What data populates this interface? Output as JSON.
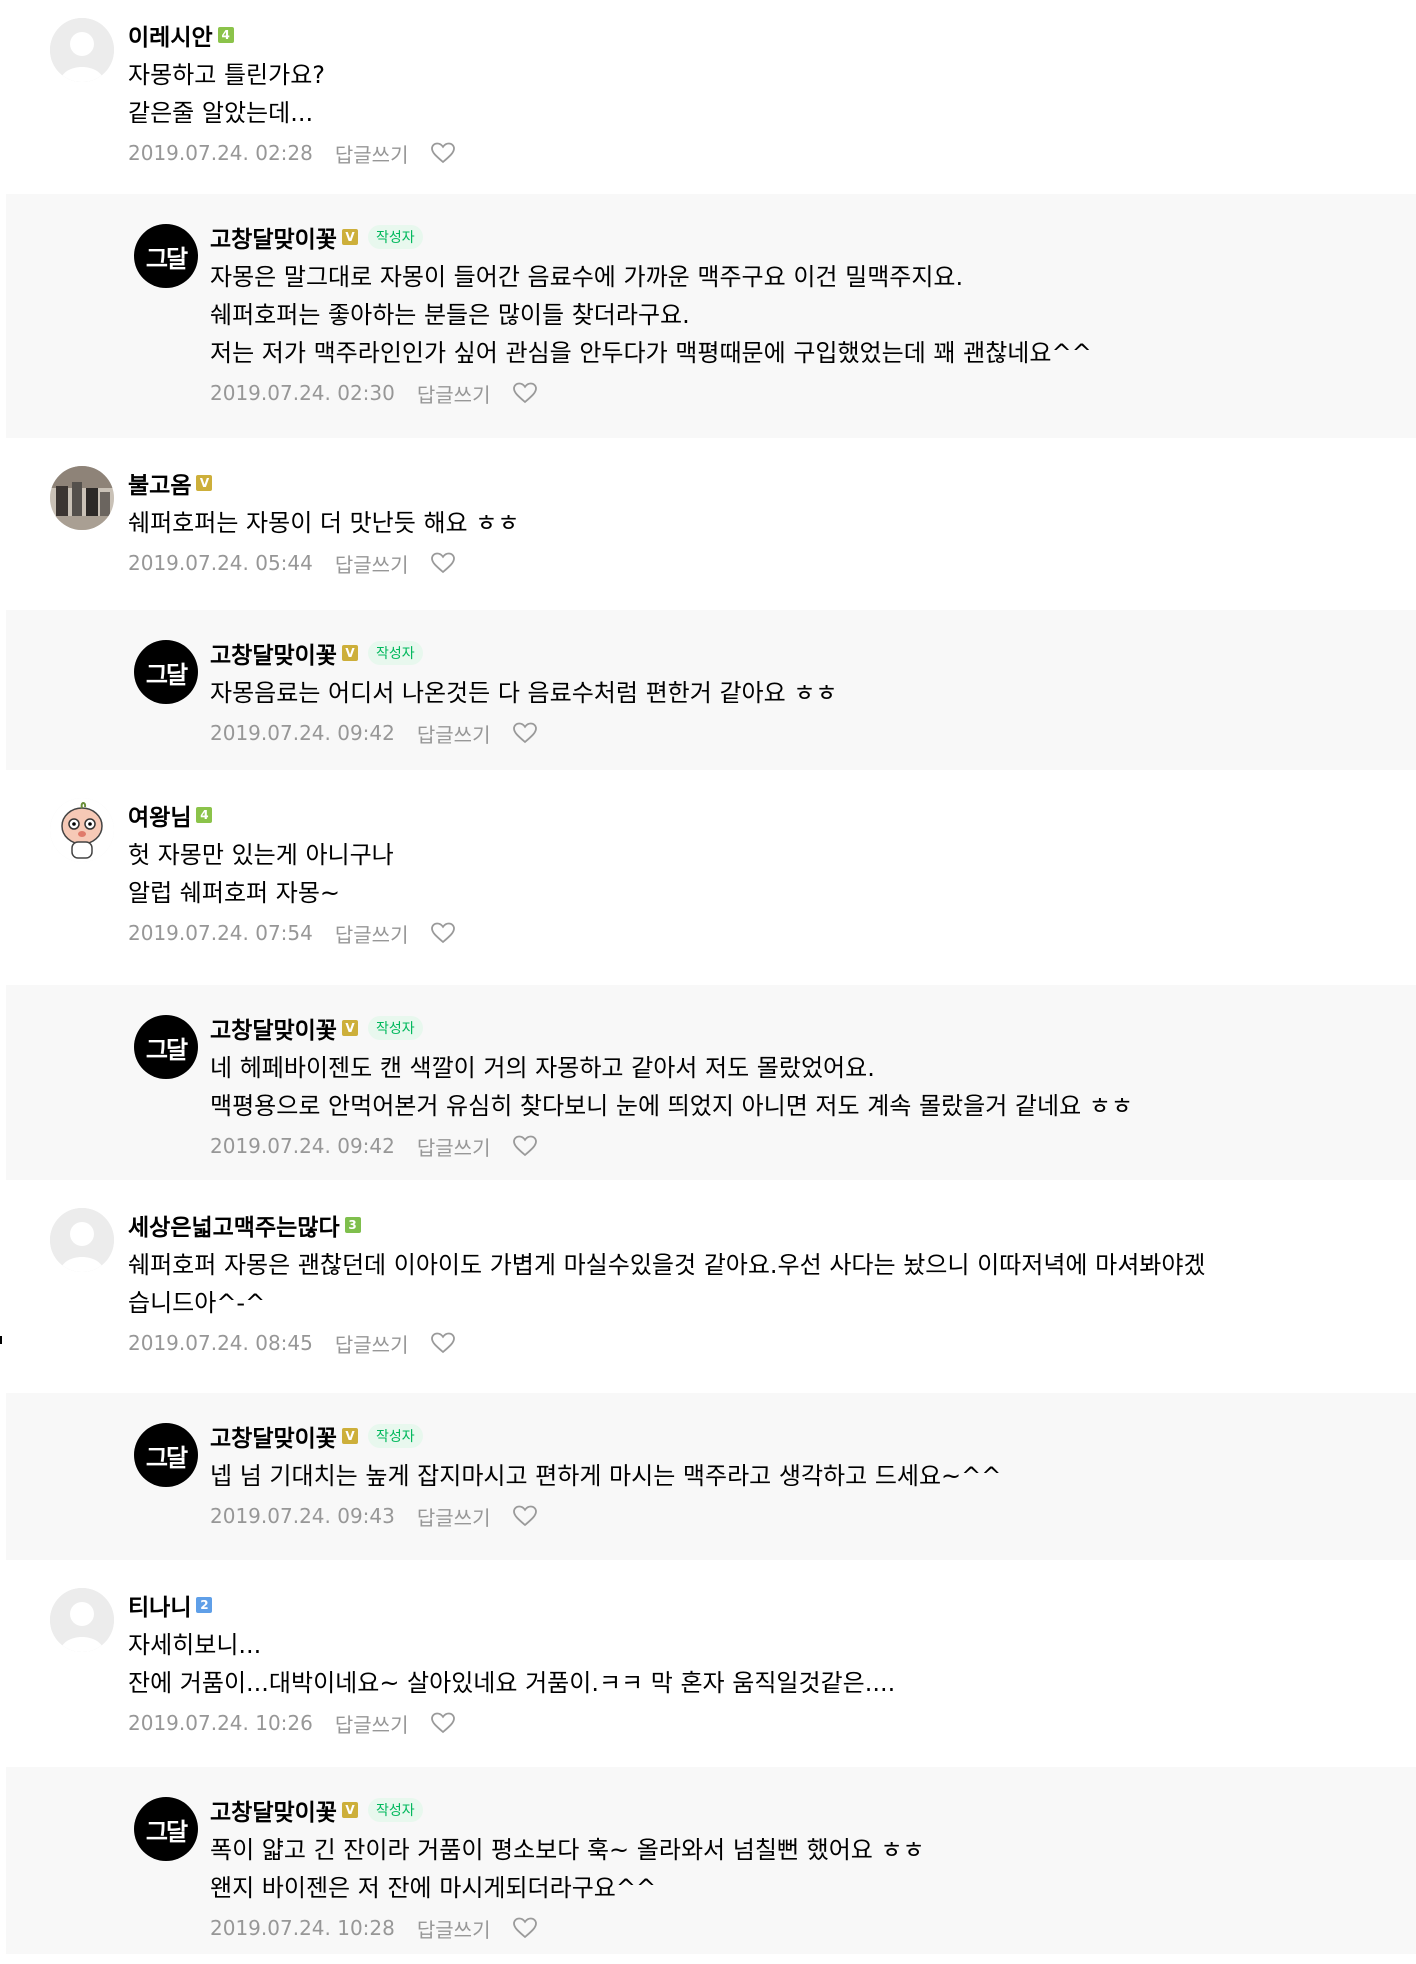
{
  "colors": {
    "level_green": "#8bc34a",
    "level_gold": "#cdaf3a",
    "level_blue": "#5f9fe8",
    "level_green_dark": "#7fbf4d",
    "author_badge_bg": "#e8f8ee",
    "author_badge_text": "#00b85c",
    "meta_text": "#979797",
    "reply_bg": "#f8f8f8"
  },
  "labels": {
    "reply_button": "답글쓰기",
    "author_badge": "작성자"
  },
  "comments": [
    {
      "type": "top",
      "nickname": "이레시안",
      "level_icon": "level-4-icon",
      "level_text": "4",
      "level_color": "#8bc34a",
      "avatar_icon": "default-avatar-icon",
      "lines": [
        "자몽하고 틀린가요?",
        "같은줄 알았는데..."
      ],
      "date": "2019.07.24. 02:28"
    },
    {
      "type": "reply",
      "nickname": "고창달맞이꽃",
      "level_icon": "level-v-icon",
      "level_text": "V",
      "level_color": "#cdaf3a",
      "avatar_icon": "blog-logo-avatar",
      "avatar_text": "그달",
      "lines": [
        "자몽은 말그대로 자몽이 들어간 음료수에 가까운 맥주구요 이건 밀맥주지요.",
        "쉐퍼호퍼는 좋아하는 분들은 많이들 찾더라구요.",
        "저는 저가 맥주라인인가 싶어 관심을 안두다가 맥평때문에 구입했었는데 꽤 괜찮네요^^"
      ],
      "date": "2019.07.24. 02:30"
    },
    {
      "type": "top",
      "nickname": "불고옴",
      "level_icon": "level-v-icon",
      "level_text": "V",
      "level_color": "#cdaf3a",
      "avatar_icon": "photo-avatar",
      "lines": [
        "쉐퍼호퍼는 자몽이 더 맛난듯 해요 ㅎㅎ"
      ],
      "date": "2019.07.24. 05:44"
    },
    {
      "type": "reply",
      "nickname": "고창달맞이꽃",
      "level_icon": "level-v-icon",
      "level_text": "V",
      "level_color": "#cdaf3a",
      "avatar_icon": "blog-logo-avatar",
      "avatar_text": "그달",
      "lines": [
        "자몽음료는 어디서 나온것든 다 음료수처럼 편한거 같아요 ㅎㅎ"
      ],
      "date": "2019.07.24. 09:42"
    },
    {
      "type": "top",
      "nickname": "여왕님",
      "level_icon": "level-4-icon",
      "level_text": "4",
      "level_color": "#8bc34a",
      "avatar_icon": "character-avatar",
      "lines": [
        "헛 자몽만 있는게 아니구나",
        "알럽 쉐퍼호퍼 자몽~"
      ],
      "date": "2019.07.24. 07:54"
    },
    {
      "type": "reply",
      "nickname": "고창달맞이꽃",
      "level_icon": "level-v-icon",
      "level_text": "V",
      "level_color": "#cdaf3a",
      "avatar_icon": "blog-logo-avatar",
      "avatar_text": "그달",
      "lines": [
        "네 헤페바이젠도 캔 색깔이 거의 자몽하고 같아서 저도 몰랐었어요.",
        "맥평용으로 안먹어본거 유심히 찾다보니 눈에 띄었지 아니면 저도 계속 몰랐을거 같네요 ㅎㅎ"
      ],
      "date": "2019.07.24. 09:42"
    },
    {
      "type": "top",
      "nickname": "세상은넓고맥주는많다",
      "level_icon": "level-3-icon",
      "level_text": "3",
      "level_color": "#7fbf4d",
      "avatar_icon": "default-avatar-icon",
      "lines": [
        "쉐퍼호퍼 자몽은 괜찮던데 이아이도 가볍게 마실수있을것 같아요.우선 사다는 놨으니 이따저녁에 마셔봐야겠",
        "습니드아^-^"
      ],
      "date": "2019.07.24. 08:45"
    },
    {
      "type": "reply",
      "nickname": "고창달맞이꽃",
      "level_icon": "level-v-icon",
      "level_text": "V",
      "level_color": "#cdaf3a",
      "avatar_icon": "blog-logo-avatar",
      "avatar_text": "그달",
      "lines": [
        "넵 넘 기대치는 높게 잡지마시고 편하게 마시는 맥주라고 생각하고 드세요~^^"
      ],
      "date": "2019.07.24. 09:43"
    },
    {
      "type": "top",
      "nickname": "티나니",
      "level_icon": "level-2-icon",
      "level_text": "2",
      "level_color": "#5f9fe8",
      "avatar_icon": "default-avatar-icon",
      "lines": [
        "자세히보니...",
        "잔에 거품이...대박이네요~ 살아있네요 거품이.ㅋㅋ 막 혼자 움직일것같은...."
      ],
      "date": "2019.07.24. 10:26"
    },
    {
      "type": "reply",
      "nickname": "고창달맞이꽃",
      "level_icon": "level-v-icon",
      "level_text": "V",
      "level_color": "#cdaf3a",
      "avatar_icon": "blog-logo-avatar",
      "avatar_text": "그달",
      "lines": [
        "폭이 얇고 긴 잔이라 거품이 평소보다 훅~ 올라와서 넘칠뻔 했어요 ㅎㅎ",
        "왠지 바이젠은 저 잔에 마시게되더라구요^^"
      ],
      "date": "2019.07.24. 10:28"
    }
  ]
}
